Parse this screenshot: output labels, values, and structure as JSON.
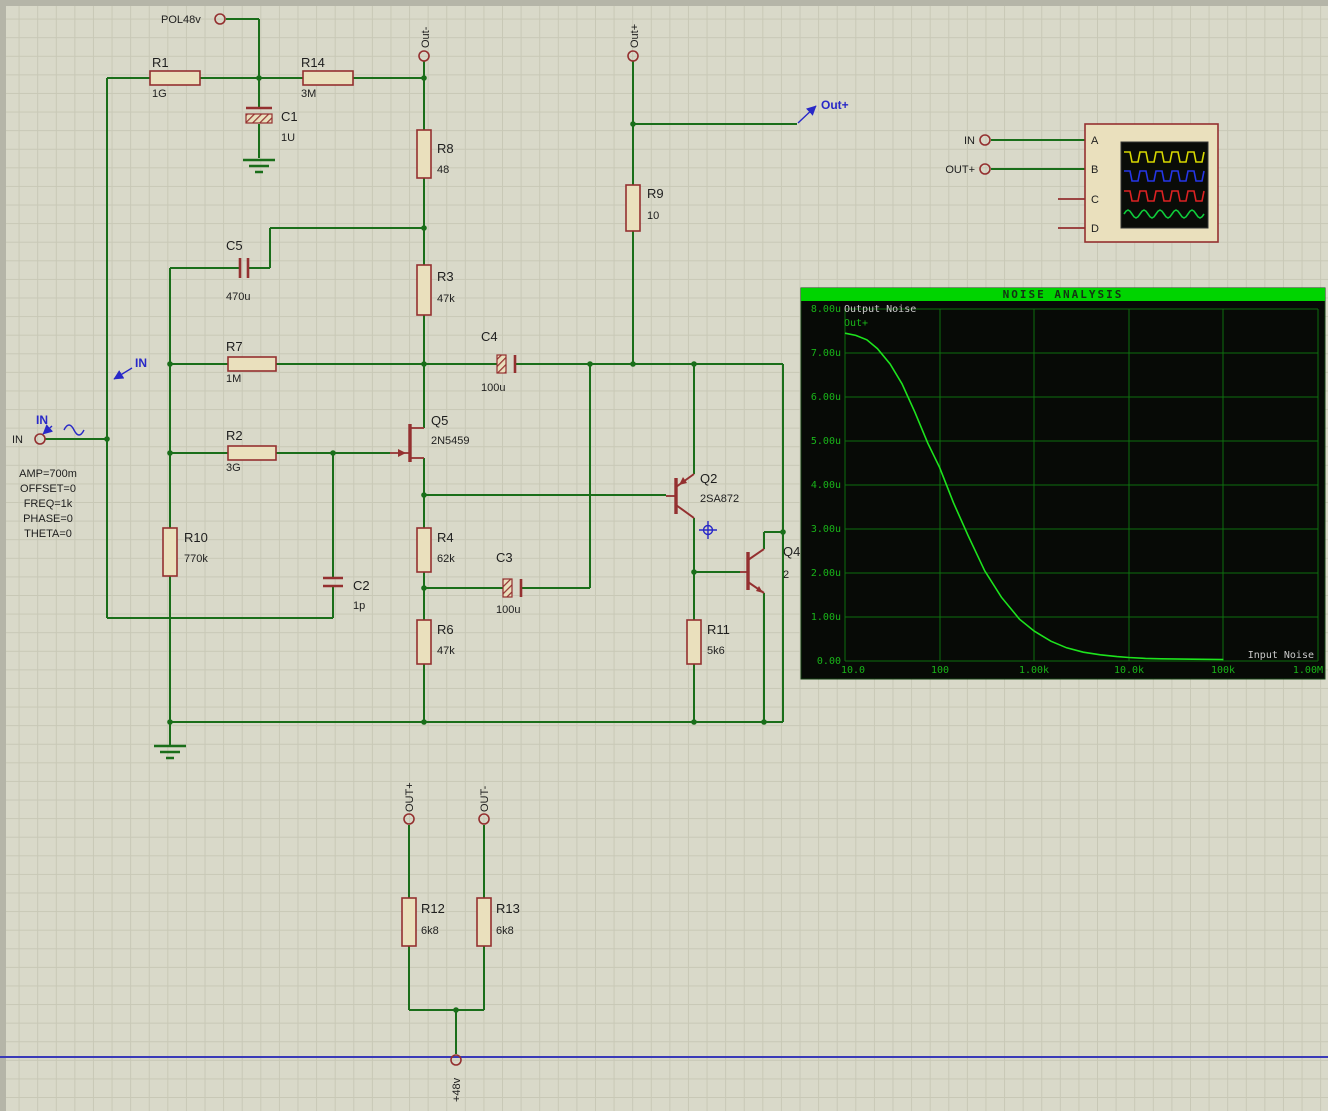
{
  "colors": {
    "bg": "#d9d9c9",
    "grid": "#c8c8b6",
    "edge": "#b5b5a8",
    "sheetline": "#3a3ab8",
    "wire": "#1a6e1a",
    "component": "#943030",
    "component_fill": "#eae0bd",
    "text": "#1e1e1e",
    "blue": "#2828c8",
    "chart_bg": "#070a06",
    "chart_titlebar": "#00d400",
    "chart_grid": "#0e6e0e",
    "chart_tick": "#19b419",
    "chart_label": "#c9c9c9"
  },
  "terminals": {
    "pol48v": "POL48v",
    "out_minus_top": "Out-",
    "out_plus_top": "Out+",
    "in_left": "IN",
    "out_plus_bottom": "OUT+",
    "out_minus_bottom": "OUT-",
    "plus48v": "+48v"
  },
  "wire_labels": {
    "in_upper": "IN",
    "in_lower": "IN",
    "out_plus": "Out+"
  },
  "generator": {
    "params": [
      "AMP=700m",
      "OFFSET=0",
      "FREQ=1k",
      "PHASE=0",
      "THETA=0"
    ]
  },
  "components": {
    "r1": {
      "ref": "R1",
      "value": "1G"
    },
    "r14": {
      "ref": "R14",
      "value": "3M"
    },
    "c1": {
      "ref": "C1",
      "value": "1U"
    },
    "r8": {
      "ref": "R8",
      "value": "48"
    },
    "r3": {
      "ref": "R3",
      "value": "47k"
    },
    "c5": {
      "ref": "C5",
      "value": "470u"
    },
    "r7": {
      "ref": "R7",
      "value": "1M"
    },
    "c4": {
      "ref": "C4",
      "value": "100u"
    },
    "r2": {
      "ref": "R2",
      "value": "3G"
    },
    "q5": {
      "ref": "Q5",
      "value": "2N5459"
    },
    "r10": {
      "ref": "R10",
      "value": "770k"
    },
    "c2": {
      "ref": "C2",
      "value": "1p"
    },
    "r4": {
      "ref": "R4",
      "value": "62k"
    },
    "c3": {
      "ref": "C3",
      "value": "100u"
    },
    "r6": {
      "ref": "R6",
      "value": "47k"
    },
    "r9": {
      "ref": "R9",
      "value": "10"
    },
    "q2": {
      "ref": "Q2",
      "value": "2SA872"
    },
    "q4": {
      "ref": "Q4",
      "value": "2"
    },
    "r11": {
      "ref": "R11",
      "value": "5k6"
    },
    "r12": {
      "ref": "R12",
      "value": "6k8"
    },
    "r13": {
      "ref": "R13",
      "value": "6k8"
    }
  },
  "scope": {
    "input_labels": {
      "a": "IN",
      "b": "OUT+"
    },
    "channels": [
      {
        "id": "A",
        "color": "#d8d800",
        "wave": "square"
      },
      {
        "id": "B",
        "color": "#2536e8",
        "wave": "square"
      },
      {
        "id": "C",
        "color": "#dd2222",
        "wave": "square"
      },
      {
        "id": "D",
        "color": "#0ecc3a",
        "wave": "sine"
      }
    ]
  },
  "chart_data": {
    "type": "line",
    "title": "NOISE ANALYSIS",
    "trace_label": "Output Noise",
    "trace_name": "Out+",
    "legend_right": "Input Noise",
    "x_scale": "log",
    "x_ticks": [
      "10.0",
      "100",
      "1.00k",
      "10.0k",
      "100k",
      "1.00M"
    ],
    "y_ticks": [
      "8.00u",
      "7.00u",
      "6.00u",
      "5.00u",
      "4.00u",
      "3.00u",
      "2.00u",
      "1.00u",
      "0.00"
    ],
    "x_range_hz": [
      10,
      1000000
    ],
    "y_range_u": [
      0,
      8
    ],
    "grid": true,
    "series": [
      {
        "name": "Out+",
        "color": "#1de31d",
        "points_hz_u": [
          [
            10,
            7.45
          ],
          [
            13,
            7.4
          ],
          [
            17,
            7.3
          ],
          [
            22,
            7.1
          ],
          [
            30,
            6.75
          ],
          [
            40,
            6.3
          ],
          [
            55,
            5.65
          ],
          [
            75,
            4.95
          ],
          [
            100,
            4.4
          ],
          [
            140,
            3.6
          ],
          [
            200,
            2.85
          ],
          [
            300,
            2.05
          ],
          [
            450,
            1.45
          ],
          [
            700,
            0.95
          ],
          [
            1000,
            0.68
          ],
          [
            1500,
            0.45
          ],
          [
            2200,
            0.3
          ],
          [
            3300,
            0.2
          ],
          [
            5000,
            0.14
          ],
          [
            7500,
            0.1
          ],
          [
            10000,
            0.08
          ],
          [
            15000,
            0.06
          ],
          [
            22000,
            0.05
          ],
          [
            47000,
            0.04
          ],
          [
            100000,
            0.035
          ]
        ]
      }
    ]
  }
}
